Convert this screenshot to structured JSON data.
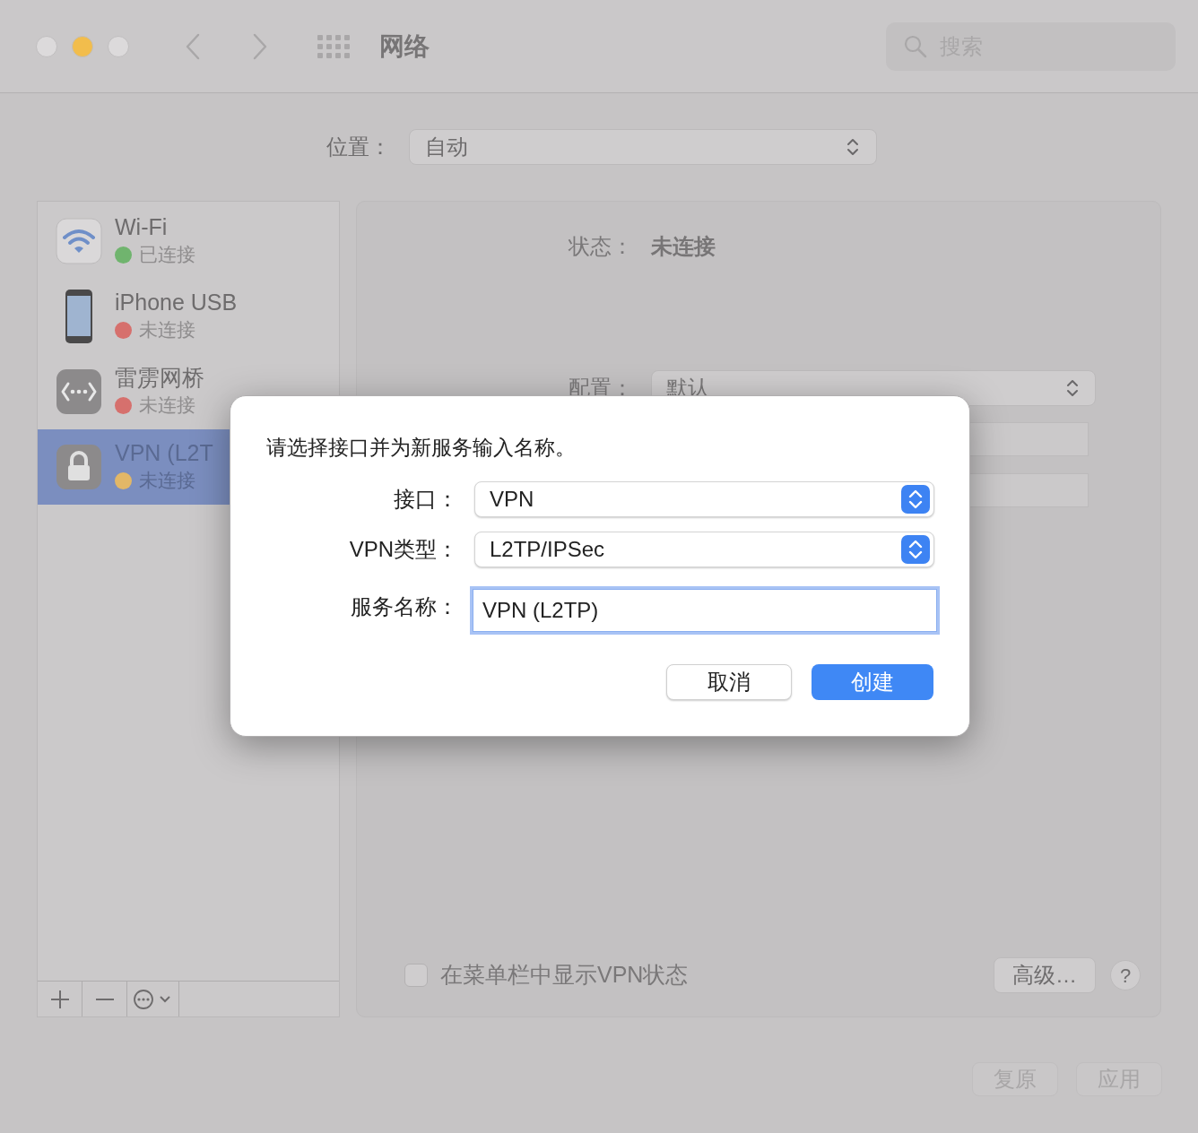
{
  "window": {
    "title": "网络",
    "search": {
      "placeholder": "搜索"
    }
  },
  "location": {
    "label": "位置：",
    "value": "自动"
  },
  "services": [
    {
      "name": "Wi-Fi",
      "status": "已连接",
      "color": "#70b46e",
      "kind": "wifi",
      "selected": false
    },
    {
      "name": "iPhone USB",
      "status": "未连接",
      "color": "#d6706d",
      "kind": "phone",
      "selected": false
    },
    {
      "name": "雷雳网桥",
      "status": "未连接",
      "color": "#d6706d",
      "kind": "bridge",
      "selected": false
    },
    {
      "name": "VPN (L2T",
      "status": "未连接",
      "color": "#e2b767",
      "kind": "lock",
      "selected": true
    }
  ],
  "detail": {
    "status_label": "状态：",
    "status_value": "未连接",
    "config_label": "配置：",
    "config_value": "默认",
    "show_in_menu_bar": {
      "label": "在菜单栏中显示VPN状态",
      "checked": false
    },
    "advanced_button": "高级…",
    "help_button": "?"
  },
  "footer_buttons": [
    {
      "label": "复原",
      "disabled": true
    },
    {
      "label": "应用",
      "disabled": true
    }
  ],
  "dialog": {
    "prompt": "请选择接口并为新服务输入名称。",
    "fields": [
      {
        "label": "接口：",
        "kind": "popup",
        "value": "VPN"
      },
      {
        "label": "VPN类型：",
        "kind": "popup",
        "value": "L2TP/IPSec"
      },
      {
        "label": "服务名称：",
        "kind": "text",
        "value": "VPN (L2TP)",
        "focused": true
      }
    ],
    "buttons": [
      {
        "label": "取消",
        "default": false
      },
      {
        "label": "创建",
        "default": true
      }
    ]
  }
}
